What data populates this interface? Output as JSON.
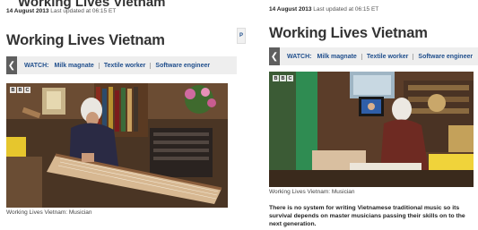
{
  "left_panel": {
    "ghost_title": "Working Lives Vietnam",
    "dateline_date": "14 August 2013",
    "dateline_updated": "Last updated at 06:15 ET",
    "title": "Working Lives Vietnam",
    "side_tab_label": "P",
    "watch_label": "WATCH:",
    "watch_links": [
      "Milk magnate",
      "Textile worker",
      "Software engineer"
    ],
    "video_caption": "Working Lives Vietnam: Musician",
    "bbc_letters": [
      "B",
      "B",
      "C"
    ]
  },
  "right_panel": {
    "dateline_date": "14 August 2013",
    "dateline_updated": "Last updated at 06:15 ET",
    "title": "Working Lives Vietnam",
    "watch_label": "WATCH:",
    "watch_links": [
      "Milk magnate",
      "Textile worker",
      "Software engineer"
    ],
    "video_caption": "Working Lives Vietnam: Musician",
    "summary": "There is no system for writing Vietnamese traditional music so its survival depends on master musicians passing their skills on to the next generation.",
    "bbc_letters": [
      "B",
      "B",
      "C"
    ]
  },
  "icons": {
    "prev": "chevron-left-icon"
  }
}
